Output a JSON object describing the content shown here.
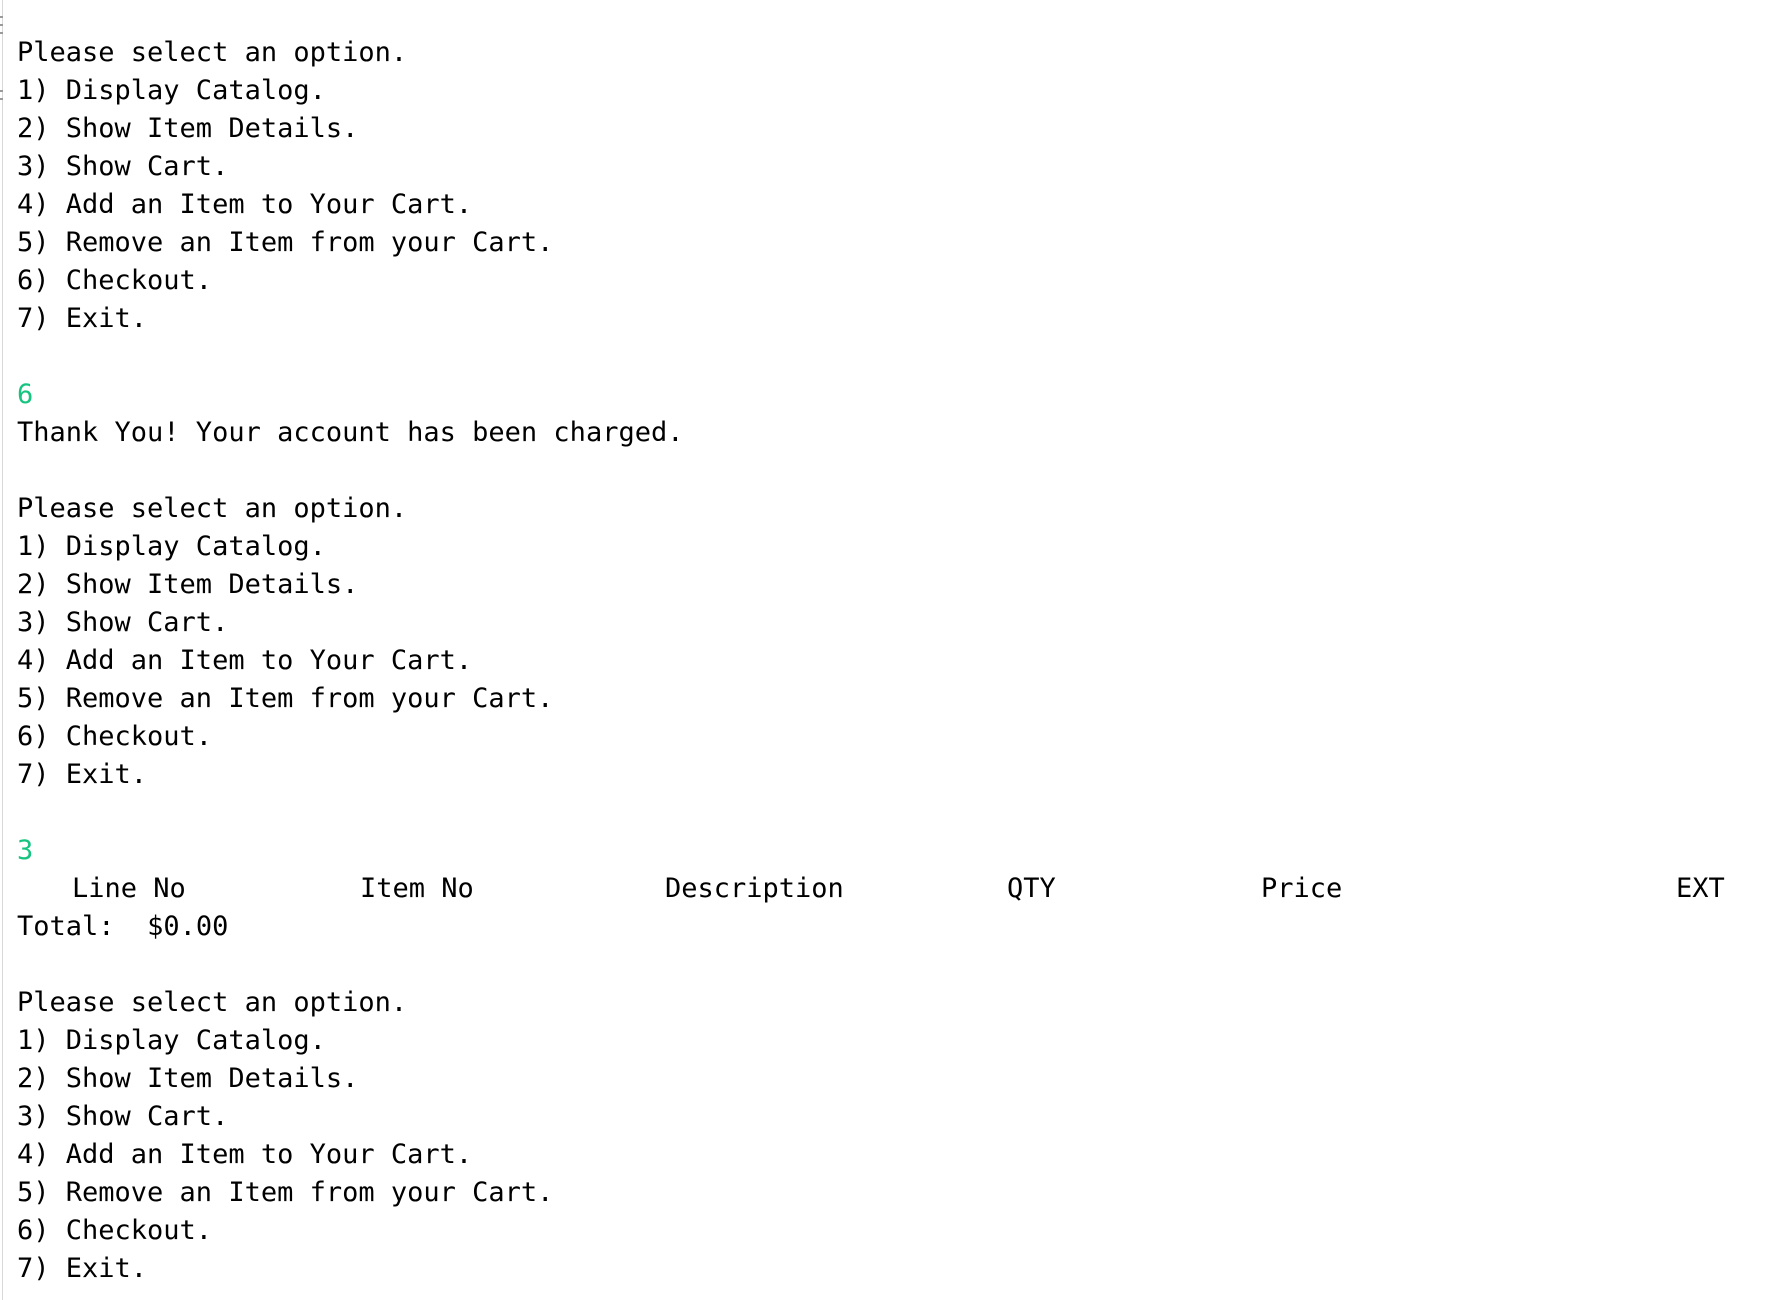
{
  "menu": {
    "prompt": "Please select an option.",
    "options": [
      "1) Display Catalog.",
      "2) Show Item Details.",
      "3) Show Cart.",
      "4) Add an Item to Your Cart.",
      "5) Remove an Item from your Cart.",
      "6) Checkout.",
      "7) Exit."
    ]
  },
  "session": {
    "input_1": "6",
    "checkout_message": "Thank You! Your account has been charged.",
    "input_2": "3",
    "cart_headers": {
      "line_no": "Line No",
      "item_no": "Item No",
      "description": "Description",
      "qty": "QTY",
      "price": "Price",
      "ext": "EXT"
    },
    "total_label": "Total:",
    "total_value": "$0.00"
  },
  "colors": {
    "user_input": "#16c47f",
    "text": "#000000",
    "background": "#ffffff"
  }
}
